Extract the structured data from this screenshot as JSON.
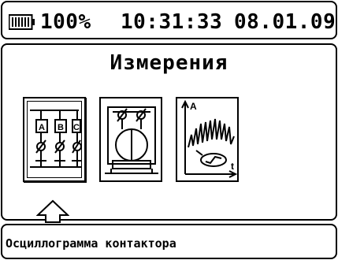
{
  "status_bar": {
    "battery_icon": "battery-icon",
    "battery_percent": "100%",
    "time": "10:31:33",
    "date": "08.01.09"
  },
  "screen": {
    "title": "Измерения",
    "tiles": [
      {
        "icon": "three-phase-contacts-icon",
        "labels": [
          "A",
          "B",
          "C"
        ],
        "selected": true
      },
      {
        "icon": "motor-diagram-icon",
        "selected": false
      },
      {
        "icon": "waveform-graph-icon",
        "axis_y": "A",
        "axis_x": "t",
        "selected": false
      }
    ],
    "selector_icon": "up-arrow-icon"
  },
  "footer": {
    "caption": "Осциллограмма контактора"
  }
}
